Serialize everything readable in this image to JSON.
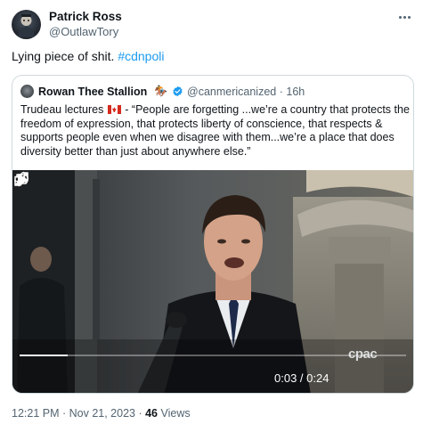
{
  "tweet": {
    "author_name": "Patrick Ross",
    "author_handle": "@OutlawTory",
    "more_icon": "more-horizontal-icon",
    "text": "Lying piece of shit. ",
    "hashtag": "#cdnpoli"
  },
  "quote": {
    "author_name": "Rowan Thee Stallion",
    "author_emoji": "🏇",
    "verified_icon": "verified-badge-icon",
    "author_handle": "@canmericanized",
    "separator": "·",
    "time": "16h",
    "text_before_flag": "Trudeau lectures",
    "flag_icon": "canada-flag-icon",
    "text_after_flag": " - “People are forgetting ...we’re a country that protects the freedom of expression, that protects liberty of conscience, that respects & supports people even when we disagree with them...we’re a place that does diversity better than just about anywhere else.”"
  },
  "video": {
    "watermark": "cpac",
    "time_display": "0:03 / 0:24",
    "progress_fraction": 0.125,
    "play_icon": "play-icon",
    "volume_icon": "volume-icon",
    "loop_icon": "loop-icon",
    "fullscreen_icon": "fullscreen-icon"
  },
  "meta": {
    "timestamp": "12:21 PM · Nov 21, 2023",
    "separator": " · ",
    "views_count": "46",
    "views_label": " Views"
  },
  "colors": {
    "link": "#1d9bf0",
    "secondary_text": "#536471",
    "border": "#cfd9de",
    "verified": "#1d9bf0"
  }
}
